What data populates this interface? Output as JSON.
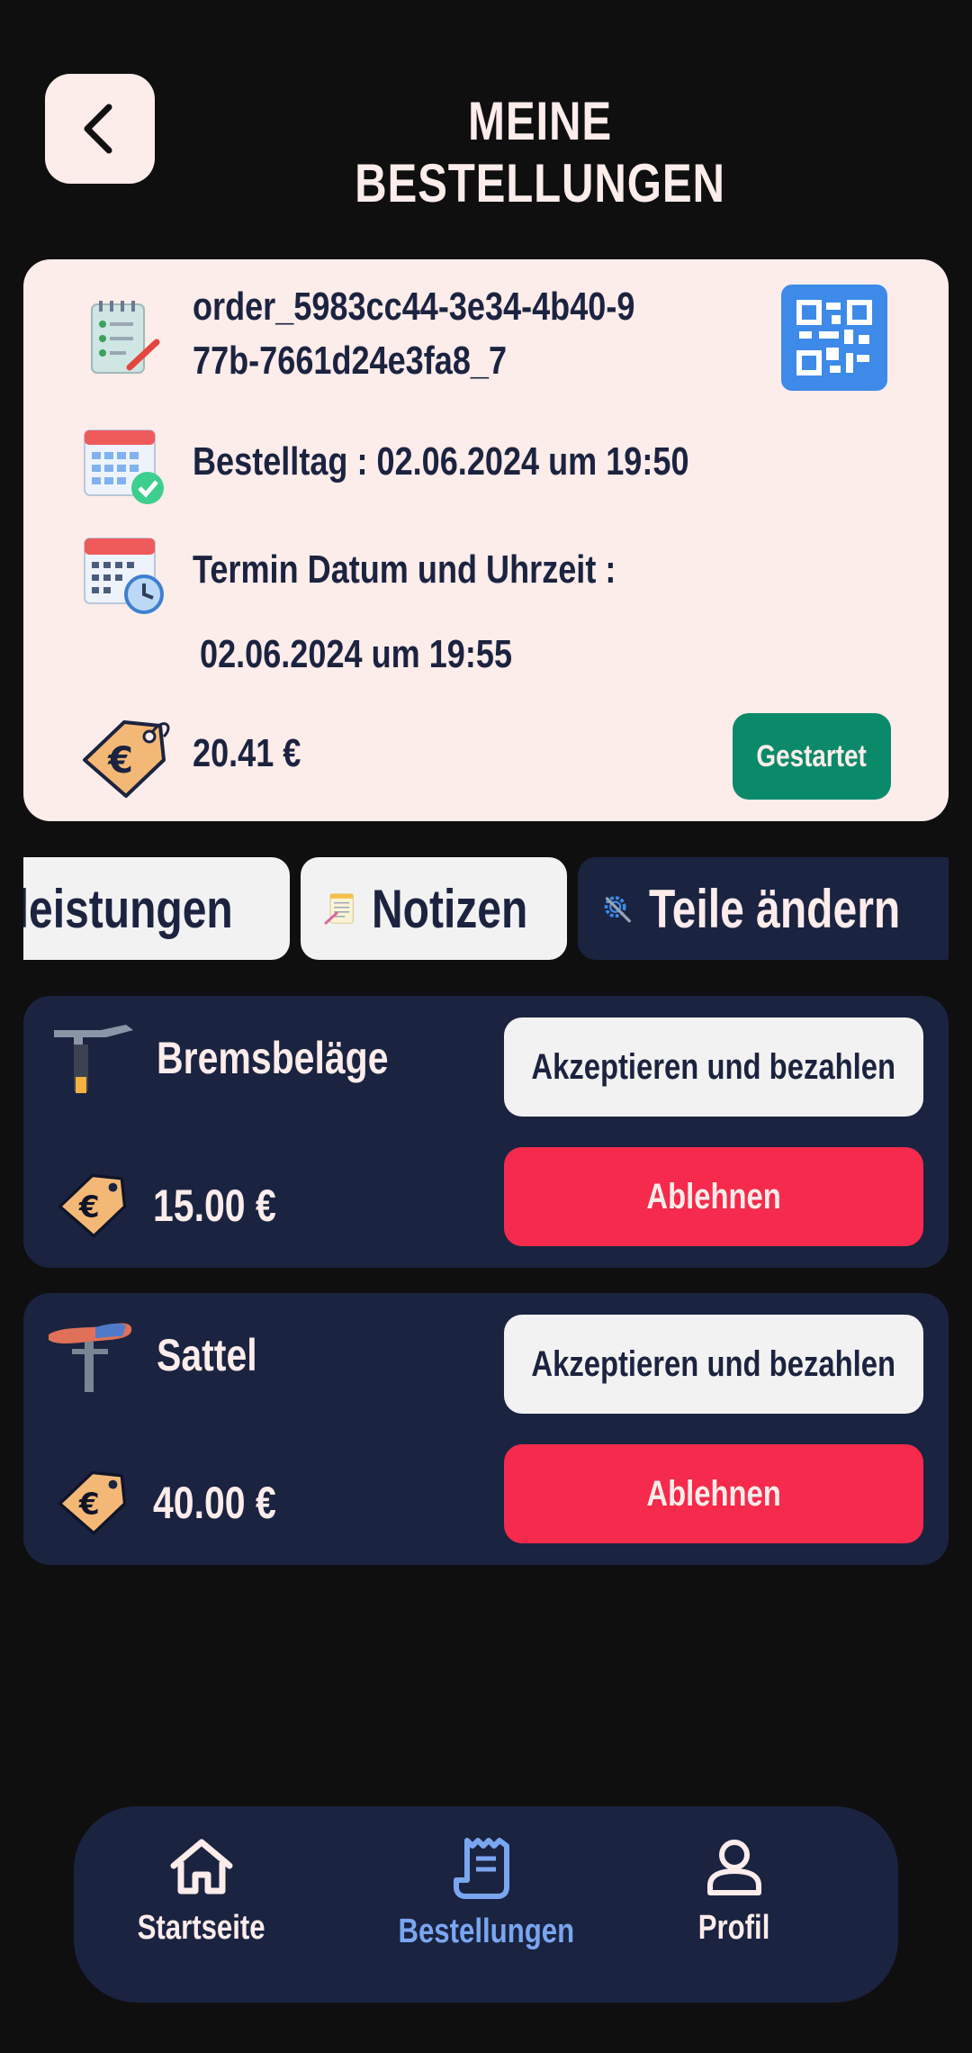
{
  "header": {
    "title": "MEINE BESTELLUNGEN"
  },
  "order": {
    "id_line1": "order_5983cc44-3e34-4b40-9",
    "id_line2": "77b-7661d24e3fa8_7",
    "order_date": "Bestelltag : 02.06.2024 um 19:50",
    "appointment_label": "Termin Datum und Uhrzeit :",
    "appointment_value": "02.06.2024 um 19:55",
    "price": "20.41 €",
    "status": "Gestartet"
  },
  "tabs": [
    {
      "label": "Dienstleistungen"
    },
    {
      "label": "Notizen"
    },
    {
      "label": "Teile ändern"
    }
  ],
  "parts": [
    {
      "name": "Bremsbeläge",
      "price": "15.00 €",
      "accept_label": "Akzeptieren und bezahlen",
      "reject_label": "Ablehnen"
    },
    {
      "name": "Sattel",
      "price": "40.00 €",
      "accept_label": "Akzeptieren und bezahlen",
      "reject_label": "Ablehnen"
    }
  ],
  "nav": {
    "items": [
      {
        "label": "Startseite",
        "icon": "home-icon",
        "active": false
      },
      {
        "label": "Bestellungen",
        "icon": "receipt-icon",
        "active": true
      },
      {
        "label": "Profil",
        "icon": "user-icon",
        "active": false
      }
    ]
  },
  "colors": {
    "background": "#0f0f10",
    "card_light": "#fcecea",
    "card_dark": "#1a2340",
    "accent_blue": "#3d8ae8",
    "status_green": "#0b8a6a",
    "reject_red": "#f52a4c",
    "nav_active": "#7aa6f0"
  }
}
